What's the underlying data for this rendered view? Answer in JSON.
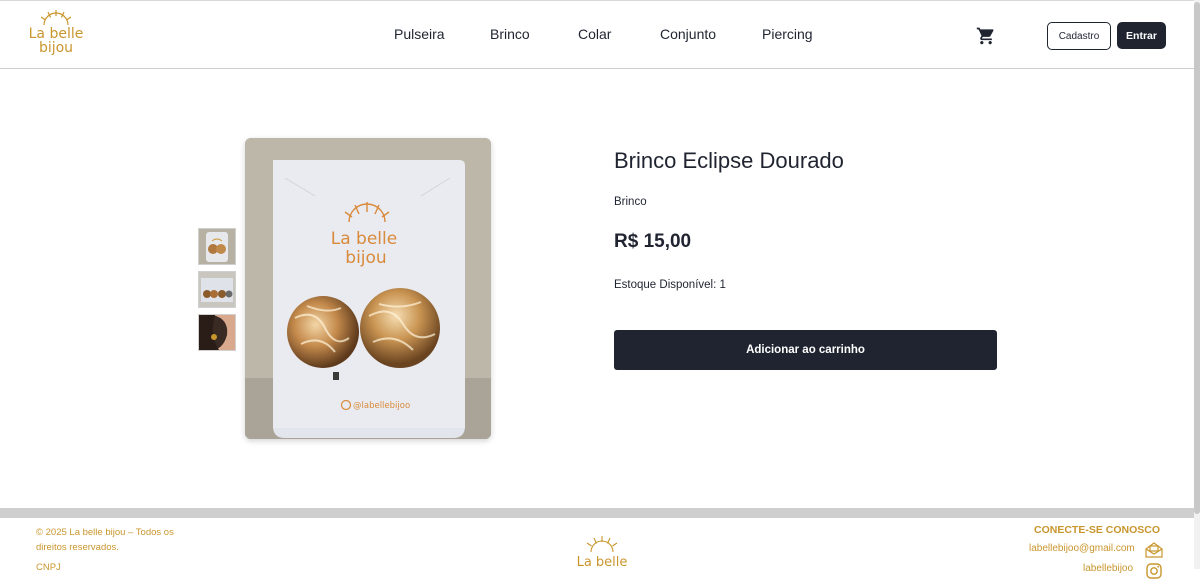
{
  "brand": {
    "logo_line1": "La belle",
    "logo_line2": "bijou"
  },
  "nav": {
    "items": [
      "Pulseira",
      "Brinco",
      "Colar",
      "Conjunto",
      "Piercing"
    ]
  },
  "header": {
    "cart_icon": "cart-icon",
    "register_label": "Cadastro",
    "login_label": "Entrar"
  },
  "product": {
    "title": "Brinco Eclipse Dourado",
    "category": "Brinco",
    "price": "R$ 15,00",
    "stock": "Estoque Disponível: 1",
    "add_to_cart": "Adicionar ao carrinho",
    "card_brand_line1": "La belle",
    "card_brand_line2": "bijou",
    "card_handle": "@labellebijoo"
  },
  "footer": {
    "copyright": "© 2025 La belle bijou – Todos os direitos reservados.",
    "copyright_extra": "CNPJ",
    "logo_text": "La belle",
    "connect_title": "CONECTE-SE CONOSCO",
    "email": "labellebijoo@gmail.com",
    "instagram": "labellebijoo"
  },
  "colors": {
    "accent": "#c9962e",
    "dark": "#1f2430"
  }
}
